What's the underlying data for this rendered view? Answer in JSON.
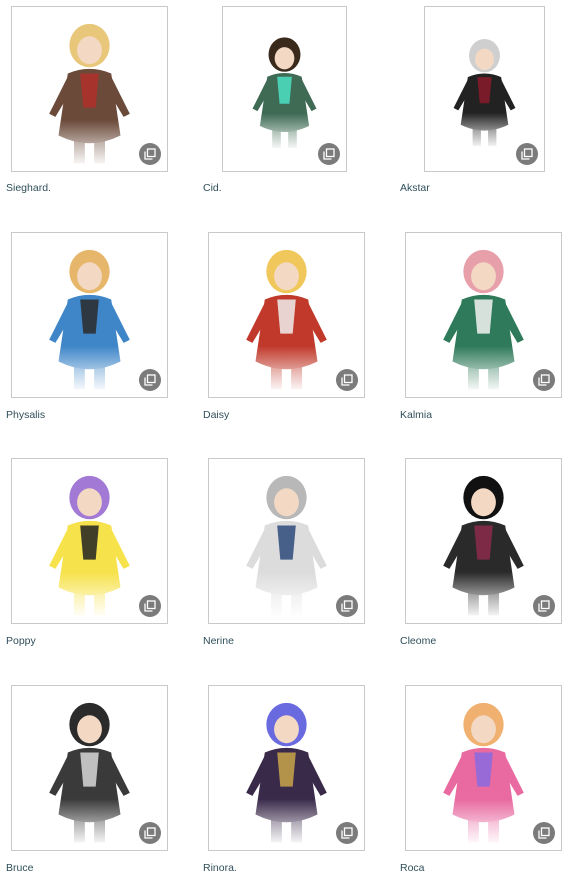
{
  "gallery": {
    "expand_icon": "expand-icon",
    "rows": [
      [
        {
          "name": "Sieghard.",
          "hair": "#e8c77a",
          "outfit": "#6b4a3a",
          "accent": "#b0302b",
          "icon": "character-portrait-icon"
        },
        {
          "name": "Cid.",
          "hair": "#3a2a1c",
          "outfit": "#3f6b55",
          "accent": "#4ce0c4",
          "icon": "character-portrait-icon"
        },
        {
          "name": "Akstar",
          "hair": "#cfcfcf",
          "outfit": "#222222",
          "accent": "#8a1a2c",
          "icon": "character-portrait-icon"
        }
      ],
      [
        {
          "name": "Physalis",
          "hair": "#e6b66a",
          "outfit": "#3f86c8",
          "accent": "#2a2a2a",
          "icon": "character-portrait-icon"
        },
        {
          "name": "Daisy",
          "hair": "#f0c75a",
          "outfit": "#c0392b",
          "accent": "#eeeeee",
          "icon": "character-portrait-icon"
        },
        {
          "name": "Kalmia",
          "hair": "#e7a0aa",
          "outfit": "#2f7a5a",
          "accent": "#f3f3f3",
          "icon": "character-portrait-icon"
        }
      ],
      [
        {
          "name": "Poppy",
          "hair": "#a27ad6",
          "outfit": "#f6e24a",
          "accent": "#222222",
          "icon": "character-portrait-icon"
        },
        {
          "name": "Nerine",
          "hair": "#b8b8b8",
          "outfit": "#dcdcdc",
          "accent": "#2d4a7a",
          "icon": "character-portrait-icon"
        },
        {
          "name": "Cleome",
          "hair": "#111111",
          "outfit": "#2a2a2a",
          "accent": "#8b2a4a",
          "icon": "character-portrait-icon"
        }
      ],
      [
        {
          "name": "Bruce",
          "hair": "#2b2b2b",
          "outfit": "#3a3a3a",
          "accent": "#d8d8d8",
          "icon": "character-portrait-icon"
        },
        {
          "name": "Rinora.",
          "hair": "#6a6ae0",
          "outfit": "#3a2a4a",
          "accent": "#c9a64a",
          "icon": "character-portrait-icon"
        },
        {
          "name": "Roca",
          "hair": "#f0b070",
          "outfit": "#e86aa0",
          "accent": "#8a6ae0",
          "icon": "character-portrait-icon"
        }
      ]
    ]
  }
}
